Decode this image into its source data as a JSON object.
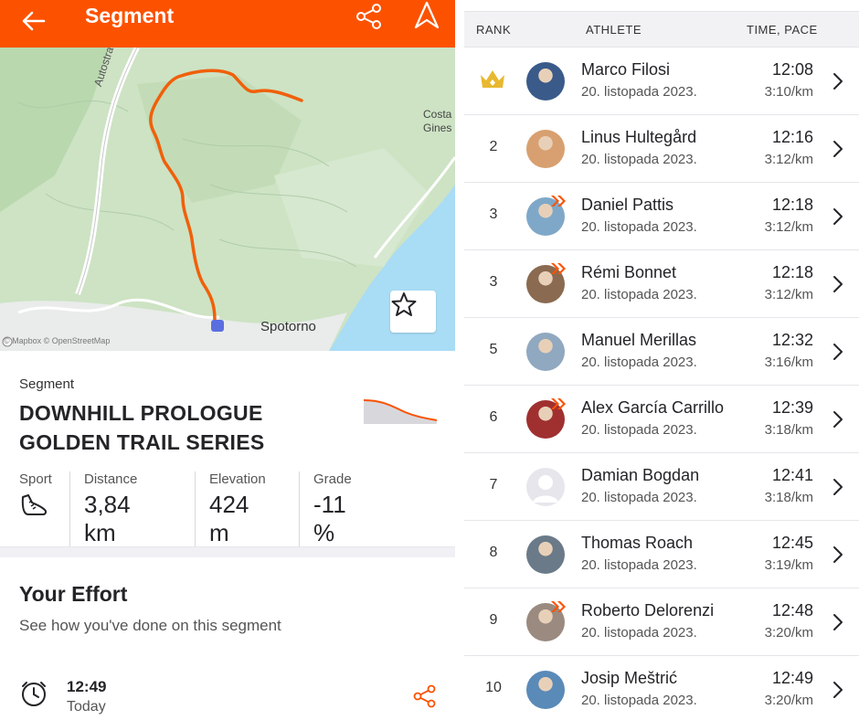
{
  "header": {
    "title": "Segment"
  },
  "map": {
    "town": "Spotorno",
    "costa_line1": "Costa",
    "costa_line2": "Gines",
    "road": "Autostrada d",
    "credit": "© Mapbox © OpenStreetMap"
  },
  "segment": {
    "label": "Segment",
    "name": "DOWNHILL PROLOGUE GOLDEN TRAIL SERIES",
    "stats": {
      "sport_label": "Sport",
      "distance_label": "Distance",
      "distance_value": "3,84 km",
      "elevation_label": "Elevation",
      "elevation_value": "424 m",
      "grade_label": "Grade",
      "grade_value": "-11 %"
    }
  },
  "effort": {
    "title": "Your Effort",
    "subtitle": "See how you've done on this segment",
    "time": "12:49",
    "when": "Today"
  },
  "leaderboard": {
    "headers": {
      "rank": "RANK",
      "athlete": "ATHLETE",
      "time_pace": "TIME, PACE"
    },
    "rows": [
      {
        "rank": "1",
        "name": "Marco Filosi",
        "date": "20. listopada 2023.",
        "time": "12:08",
        "pace": "3:10/km",
        "crown": true,
        "badge": false
      },
      {
        "rank": "2",
        "name": "Linus Hultegård",
        "date": "20. listopada 2023.",
        "time": "12:16",
        "pace": "3:12/km",
        "crown": false,
        "badge": false
      },
      {
        "rank": "3",
        "name": "Daniel Pattis",
        "date": "20. listopada 2023.",
        "time": "12:18",
        "pace": "3:12/km",
        "crown": false,
        "badge": true
      },
      {
        "rank": "3",
        "name": "Rémi Bonnet",
        "date": "20. listopada 2023.",
        "time": "12:18",
        "pace": "3:12/km",
        "crown": false,
        "badge": true
      },
      {
        "rank": "5",
        "name": "Manuel Merillas",
        "date": "20. listopada 2023.",
        "time": "12:32",
        "pace": "3:16/km",
        "crown": false,
        "badge": false
      },
      {
        "rank": "6",
        "name": "Alex García Carrillo",
        "date": "20. listopada 2023.",
        "time": "12:39",
        "pace": "3:18/km",
        "crown": false,
        "badge": true
      },
      {
        "rank": "7",
        "name": "Damian Bogdan",
        "date": "20. listopada 2023.",
        "time": "12:41",
        "pace": "3:18/km",
        "crown": false,
        "badge": false
      },
      {
        "rank": "8",
        "name": "Thomas Roach",
        "date": "20. listopada 2023.",
        "time": "12:45",
        "pace": "3:19/km",
        "crown": false,
        "badge": false
      },
      {
        "rank": "9",
        "name": "Roberto Delorenzi",
        "date": "20. listopada 2023.",
        "time": "12:48",
        "pace": "3:20/km",
        "crown": false,
        "badge": true
      },
      {
        "rank": "10",
        "name": "Josip Meštrić",
        "date": "20. listopada 2023.",
        "time": "12:49",
        "pace": "3:20/km",
        "crown": false,
        "badge": false
      }
    ]
  },
  "colors": {
    "brand": "#fc5200",
    "crown": "#e8b830",
    "route": "#f0600a",
    "water": "#a9dcf5"
  }
}
